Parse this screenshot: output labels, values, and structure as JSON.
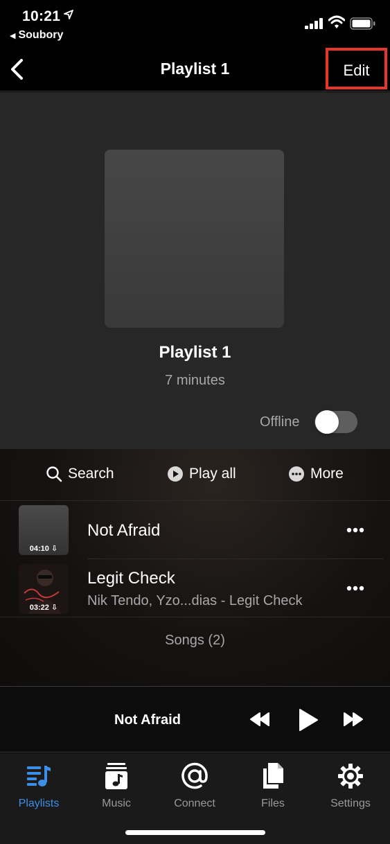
{
  "status_bar": {
    "time": "10:21",
    "back_app": "Soubory"
  },
  "nav": {
    "title": "Playlist 1",
    "edit_label": "Edit"
  },
  "playlist": {
    "name": "Playlist 1",
    "duration": "7 minutes",
    "offline_label": "Offline",
    "offline_enabled": false
  },
  "actions": {
    "search": "Search",
    "play_all": "Play all",
    "more": "More"
  },
  "songs": [
    {
      "title": "Not Afraid",
      "subtitle": "",
      "duration": "04:10"
    },
    {
      "title": "Legit Check",
      "subtitle": "Nik Tendo, Yzo...dias - Legit Check",
      "duration": "03:22"
    }
  ],
  "songs_count": "Songs (2)",
  "player": {
    "now_playing": "Not Afraid"
  },
  "tabs": [
    {
      "label": "Playlists",
      "icon": "playlists-icon",
      "active": true
    },
    {
      "label": "Music",
      "icon": "music-icon",
      "active": false
    },
    {
      "label": "Connect",
      "icon": "at-icon",
      "active": false
    },
    {
      "label": "Files",
      "icon": "files-icon",
      "active": false
    },
    {
      "label": "Settings",
      "icon": "gear-icon",
      "active": false
    }
  ],
  "colors": {
    "accent": "#3d8ee6",
    "highlight_box": "#e8372a"
  }
}
